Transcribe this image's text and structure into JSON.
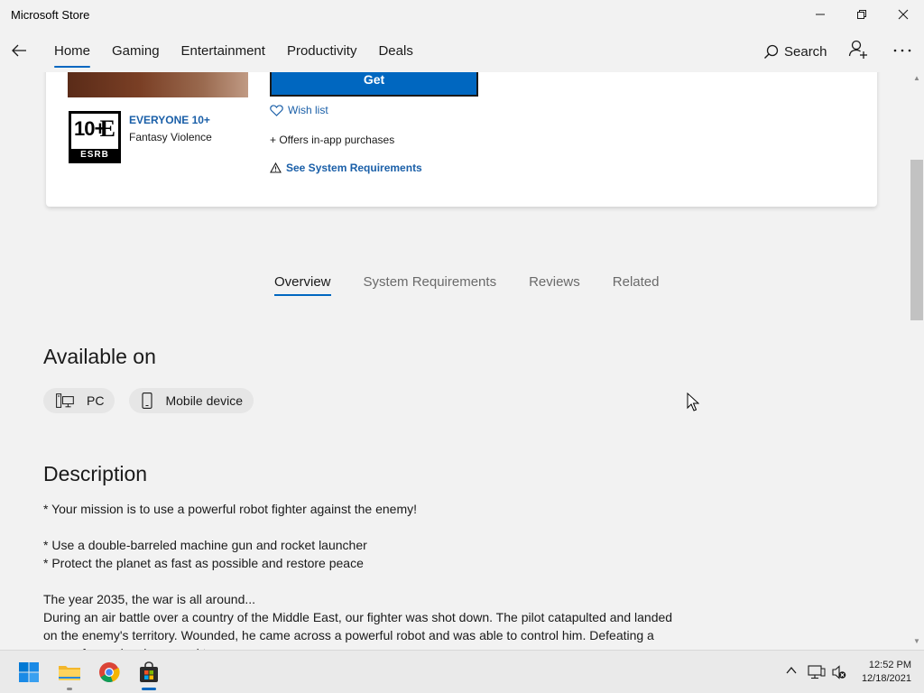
{
  "window": {
    "title": "Microsoft Store"
  },
  "nav": {
    "tabs": [
      "Home",
      "Gaming",
      "Entertainment",
      "Productivity",
      "Deals"
    ],
    "active_tab": "Home",
    "search_label": "Search"
  },
  "product": {
    "get_label": "Get",
    "rating_title": "EVERYONE 10+",
    "rating_descriptor": "Fantasy Violence",
    "esrb_number": "10+",
    "esrb_letter": "E",
    "esrb_brand": "ESRB",
    "wishlist_label": "Wish list",
    "in_app_label": "+ Offers in-app purchases",
    "sysreq_label": "See System Requirements"
  },
  "detail_tabs": {
    "items": [
      "Overview",
      "System Requirements",
      "Reviews",
      "Related"
    ],
    "active": "Overview"
  },
  "available": {
    "heading": "Available on",
    "platforms": [
      "PC",
      "Mobile device"
    ]
  },
  "description": {
    "heading": "Description",
    "paragraphs": [
      "* Your mission is to use a powerful robot fighter against the enemy!",
      "* Use a double-barreled machine gun and rocket launcher\n* Protect the planet as fast as possible and restore peace",
      "The year 2035, the war is all around...\nDuring an air battle over a country of the Middle East, our fighter was shot down. The pilot catapulted and landed on the enemy's territory. Wounded, he came across a powerful robot and was able to control him. Defeating a gang of enemies, he moved to ..."
    ]
  },
  "taskbar": {
    "apps": [
      "start-button",
      "file-explorer",
      "chrome",
      "microsoft-store"
    ],
    "time": "12:52 PM",
    "date": "12/18/2021"
  },
  "colors": {
    "accent": "#0067c0",
    "link": "#1a5fa8"
  }
}
